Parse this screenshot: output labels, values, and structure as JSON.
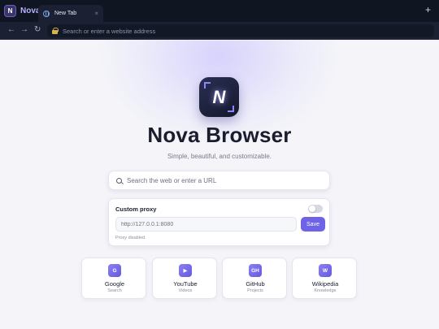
{
  "browser": {
    "brand_badge": "N",
    "brand_name": "Nova",
    "tab": {
      "title": "New Tab",
      "close_glyph": "×"
    },
    "new_tab_glyph": "+",
    "nav": {
      "back_glyph": "←",
      "forward_glyph": "→",
      "reload_glyph": "↻"
    },
    "address": {
      "placeholder": "Search or enter a website address",
      "value": ""
    }
  },
  "home": {
    "logo_letter": "N",
    "title": "Nova Browser",
    "subtitle": "Simple, beautiful, and customizable.",
    "search": {
      "placeholder": "Search the web or enter a URL",
      "value": ""
    }
  },
  "proxy": {
    "label": "Custom proxy",
    "enabled": false,
    "input_placeholder": "http://127.0.0.1:8080",
    "save_label": "Save",
    "status": "Proxy disabled"
  },
  "shortcuts": [
    {
      "icon": "G",
      "name": "Google",
      "sub": "Search"
    },
    {
      "icon": "▶",
      "name": "YouTube",
      "sub": "Videos"
    },
    {
      "icon": "GH",
      "name": "GitHub",
      "sub": "Projects"
    },
    {
      "icon": "W",
      "name": "Wikipedia",
      "sub": "Knowledge"
    }
  ],
  "colors": {
    "accent": "#6e62e6",
    "chrome_dark": "#101522",
    "page_bg": "#f4f4f9"
  }
}
